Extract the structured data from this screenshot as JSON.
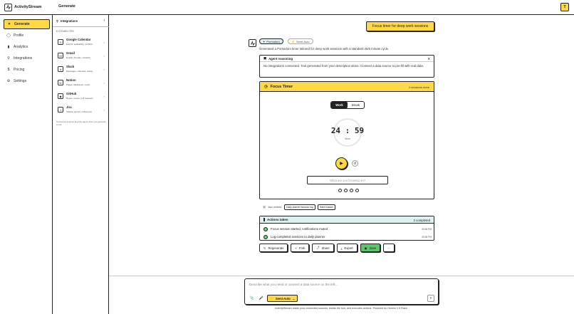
{
  "app": {
    "name": "ActivityStream",
    "page_title": "Generate",
    "user_initial": "T"
  },
  "nav": {
    "items": [
      {
        "label": "Generate",
        "icon": "sparkle-icon",
        "active": true
      },
      {
        "label": "Profile",
        "icon": "user-icon"
      },
      {
        "label": "Analytics",
        "icon": "chart-icon"
      },
      {
        "label": "Integrations",
        "icon": "plug-icon"
      },
      {
        "label": "Pricing",
        "icon": "dollar-icon"
      },
      {
        "label": "Settings",
        "icon": "gear-icon"
      }
    ]
  },
  "integrations": {
    "title": "Integrations",
    "connected_label": "6 CONNECTED",
    "items": [
      {
        "name": "Google Calendar",
        "desc": "Events, availability, conflicts",
        "icon": "G"
      },
      {
        "name": "Gmail",
        "desc": "Emails, threads, contacts",
        "icon": "M"
      },
      {
        "name": "Slack",
        "desc": "Messages, channels, status",
        "icon": "#"
      },
      {
        "name": "Notion",
        "desc": "Pages, databases, notes",
        "icon": "N"
      },
      {
        "name": "GitHub",
        "desc": "Repos, issues, pull requests",
        "icon": "◆"
      },
      {
        "name": "Jira",
        "desc": "Tickets, sprints, milestones",
        "icon": "J"
      }
    ],
    "note": "Connected sources feed the agent when you generate a tool."
  },
  "chat": {
    "user_message": "Focus timer for deep work sessions",
    "agent_tag": "Pomodoro",
    "mode_tag": "Semi-Auto",
    "generated_text": "Generated a Pomodoro timer tailored for deep work sessions with a standard 25/5 minute cycle.",
    "reasoning": {
      "title": "Agent reasoning",
      "body": "No integrations connected. Tool generated from your description alone. Connect a data source to pre-fill with real data."
    }
  },
  "timer_card": {
    "title": "Focus Timer",
    "meta": "0 sessions done",
    "tabs": [
      "Work",
      "Break"
    ],
    "time": "24 : 59",
    "time_label": "Work",
    "placeholder": "What are you focusing on?",
    "session_dots": 4
  },
  "tags": {
    "prefix": "Also created:",
    "items": [
      "Daily planner session log",
      "Habit tracker"
    ]
  },
  "actions": {
    "title": "Actions taken",
    "count": "2 completed",
    "rows": [
      {
        "text": "Focus session started, notifications muted",
        "time": "09:36 PM"
      },
      {
        "text": "Log completed sessions to daily planner",
        "time": "09:36 PM"
      }
    ]
  },
  "buttons": {
    "regenerate": "Regenerate",
    "fork": "Fork",
    "share": "Share",
    "export": "Export",
    "save": "Save",
    "more": "···"
  },
  "composer": {
    "placeholder": "Describe what you need or connect a data source on the left...",
    "mode": "Semi-Auto",
    "footer": "ActivityStream reads your connected sources, builds the tool, and executes actions. Powered by Gemini 2.5 Flash."
  }
}
